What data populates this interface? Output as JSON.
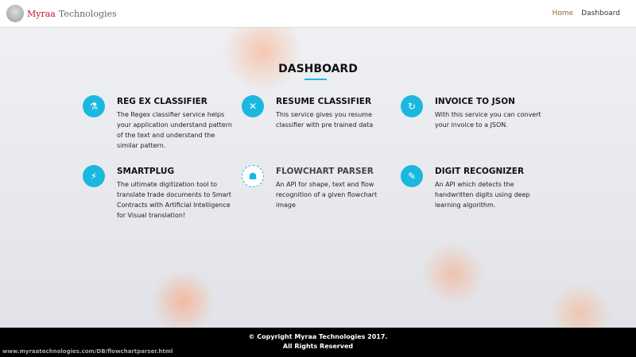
{
  "header": {
    "logo_part1": "Myraa",
    "logo_part2": " Technologies",
    "nav": [
      "Home",
      "Dashboard"
    ]
  },
  "main": {
    "title": "DASHBOARD",
    "services": [
      {
        "title": "REG EX CLASSIFIER",
        "desc": "The Regex classifier service helps your application understand pattern of the text and understand the similar pattern.",
        "icon": "regex-icon"
      },
      {
        "title": "RESUME CLASSIFIER",
        "desc": "This service gives you resume classifier with pre trained data",
        "icon": "expand-icon"
      },
      {
        "title": "INVOICE TO JSON",
        "desc": "With this service you can convert your invoice to a JSON.",
        "icon": "refresh-icon"
      },
      {
        "title": "SMARTPLUG",
        "desc": "The ultimate digitization tool to translate trade documents to Smart Contracts with Artificial Intelligence for Visual translation!",
        "icon": "plug-icon"
      },
      {
        "title": "FLOWCHART PARSER",
        "desc": "An API for shape, text and flow recognition of a given flowchart image",
        "icon": "sitemap-icon"
      },
      {
        "title": "DIGIT RECOGNIZER",
        "desc": "An API which detects the handwritten digits using deep learning algorithm.",
        "icon": "edit-icon"
      }
    ]
  },
  "footer": {
    "line1": "© Copyright Myraa Technologies 2017.",
    "line2": "All Rights Reserved"
  },
  "status_url": "www.myraatechnologies.com/DB/flowchartparser.html",
  "colors": {
    "accent": "#1ab8e0"
  }
}
